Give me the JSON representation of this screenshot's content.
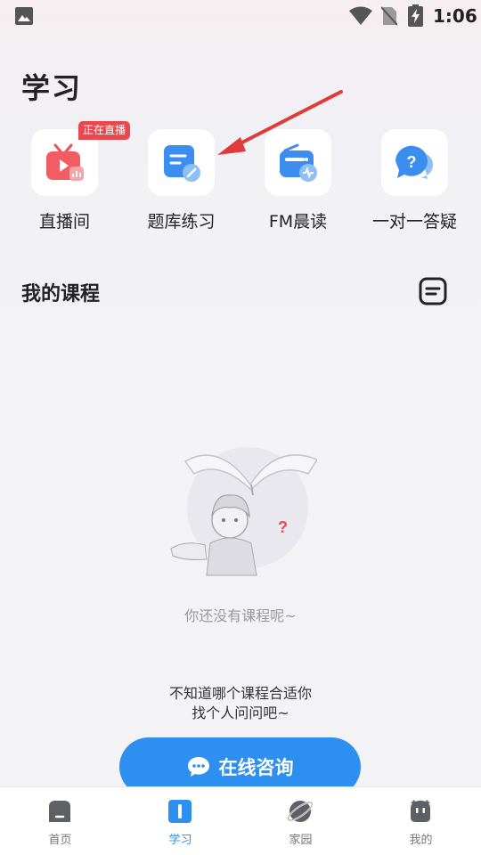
{
  "status_bar": {
    "time": "1:06",
    "icons": [
      "image-icon",
      "wifi-icon",
      "no-sim-icon",
      "battery-charging-icon"
    ]
  },
  "page_title": "学习",
  "entries": [
    {
      "label": "直播间",
      "icon": "live-tv-icon",
      "badge": "正在直播"
    },
    {
      "label": "题库练习",
      "icon": "question-bank-icon"
    },
    {
      "label": "FM晨读",
      "icon": "radio-icon"
    },
    {
      "label": "一对一答疑",
      "icon": "qa-chat-icon"
    }
  ],
  "my_courses": {
    "title": "我的课程",
    "empty_text": "你还没有课程呢~",
    "hint_line1": "不知道哪个课程合适你",
    "hint_line2": "找个人问问吧~",
    "consult_label": "在线咨询"
  },
  "tabs": [
    {
      "label": "首页",
      "icon": "home-icon",
      "active": false
    },
    {
      "label": "学习",
      "icon": "book-icon",
      "active": true
    },
    {
      "label": "家园",
      "icon": "planet-icon",
      "active": false
    },
    {
      "label": "我的",
      "icon": "profile-icon",
      "active": false
    }
  ],
  "colors": {
    "accent": "#2d8ff0",
    "live_badge": "#e8494f",
    "arrow": "#e03b3b"
  }
}
